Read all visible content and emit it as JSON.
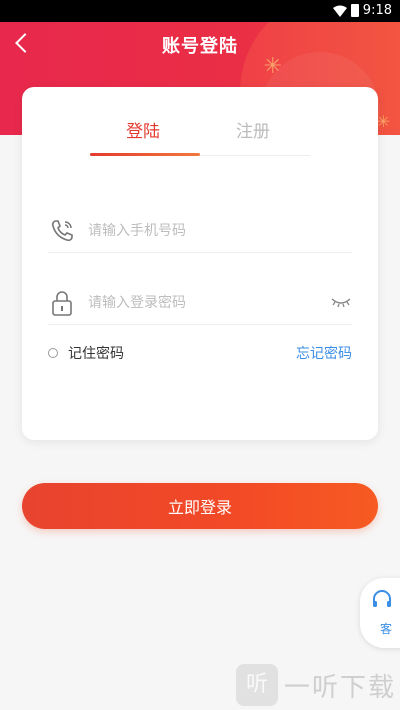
{
  "status_bar": {
    "time": "9:18"
  },
  "header": {
    "title": "账号登陆"
  },
  "tabs": {
    "login": "登陆",
    "register": "注册"
  },
  "form": {
    "phone_placeholder": "请输入手机号码",
    "password_placeholder": "请输入登录密码",
    "remember_label": "记住密码",
    "forgot_label": "忘记密码"
  },
  "login_button": "立即登录",
  "service": {
    "label": "客"
  },
  "watermark": {
    "logo": "听",
    "text": "一听下载"
  }
}
